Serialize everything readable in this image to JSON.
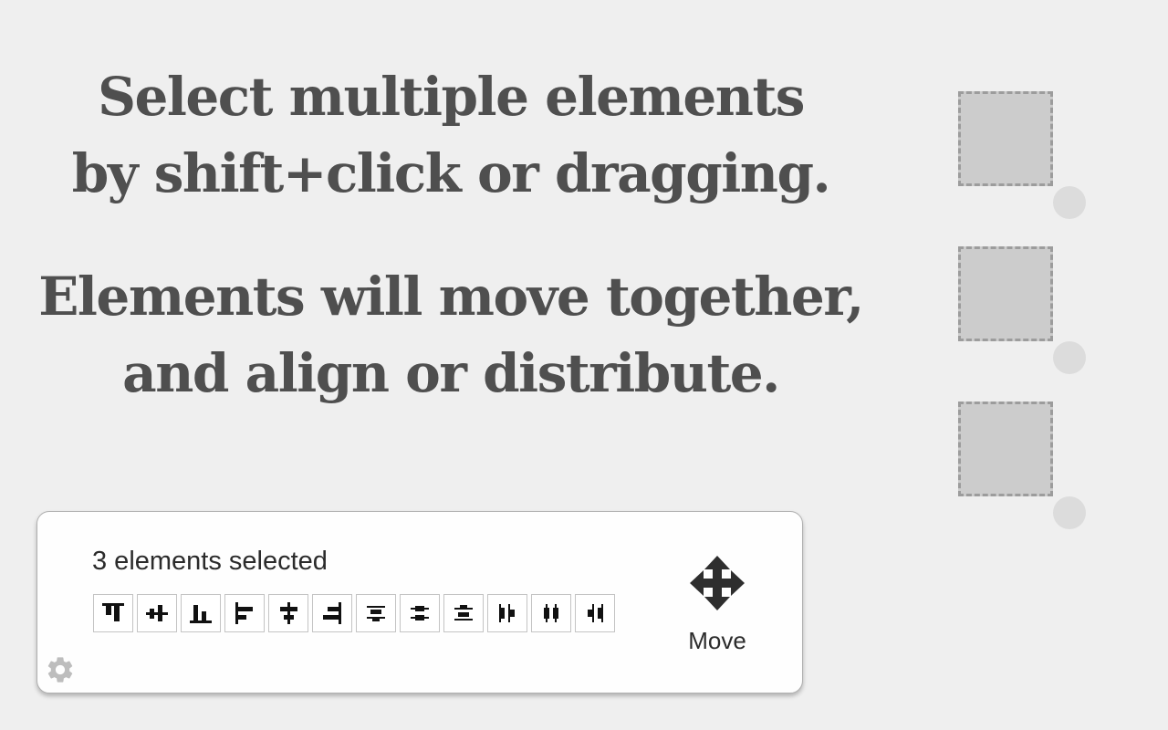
{
  "headline1": {
    "line1": "Select multiple elements",
    "line2": "by shift+click or dragging."
  },
  "headline2": {
    "line1": "Elements will move together,",
    "line2": "and align or distribute."
  },
  "toolbar": {
    "selection_text": "3 elements selected",
    "buttons": [
      {
        "icon": "align-top-icon"
      },
      {
        "icon": "align-vertical-center-icon"
      },
      {
        "icon": "align-bottom-icon"
      },
      {
        "icon": "align-left-icon"
      },
      {
        "icon": "align-horizontal-center-icon"
      },
      {
        "icon": "align-right-icon"
      },
      {
        "icon": "distribute-top-icon"
      },
      {
        "icon": "distribute-vertical-center-icon"
      },
      {
        "icon": "distribute-bottom-icon"
      },
      {
        "icon": "distribute-left-icon"
      },
      {
        "icon": "distribute-horizontal-center-icon"
      },
      {
        "icon": "distribute-right-icon"
      }
    ],
    "move_label": "Move",
    "move_icon": "move-arrows-icon",
    "settings_icon": "gear-icon"
  },
  "colors": {
    "background": "#efefef",
    "headline": "#4f4f4f",
    "element_fill": "#cccccc",
    "element_border": "#9c9c9c",
    "handle": "#dcdcdc",
    "panel": "#fefefe"
  }
}
